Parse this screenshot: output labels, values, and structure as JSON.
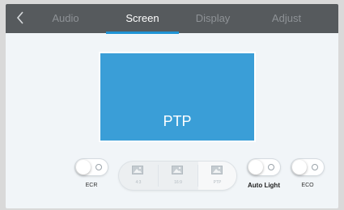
{
  "header": {
    "back_icon": "chevron-left-icon",
    "tabs": [
      {
        "label": "Audio",
        "active": false
      },
      {
        "label": "Screen",
        "active": true
      },
      {
        "label": "Display",
        "active": false
      },
      {
        "label": "Adjust",
        "active": false
      }
    ]
  },
  "preview": {
    "label": "PTP"
  },
  "controls": {
    "ecr": {
      "label": "ECR",
      "on": false
    },
    "aspect_ratios": [
      {
        "label": "4:3",
        "icon": "image-icon",
        "selected": false
      },
      {
        "label": "16:9",
        "icon": "image-icon",
        "selected": false
      },
      {
        "label": "PTP",
        "icon": "image-icon",
        "selected": true
      }
    ],
    "auto_light": {
      "label": "Auto Light",
      "on": false
    },
    "eco": {
      "label": "ECO",
      "on": false
    }
  },
  "colors": {
    "accent": "#1f93d4",
    "preview_fill": "#3a9ed7",
    "topbar": "#565a5d"
  }
}
